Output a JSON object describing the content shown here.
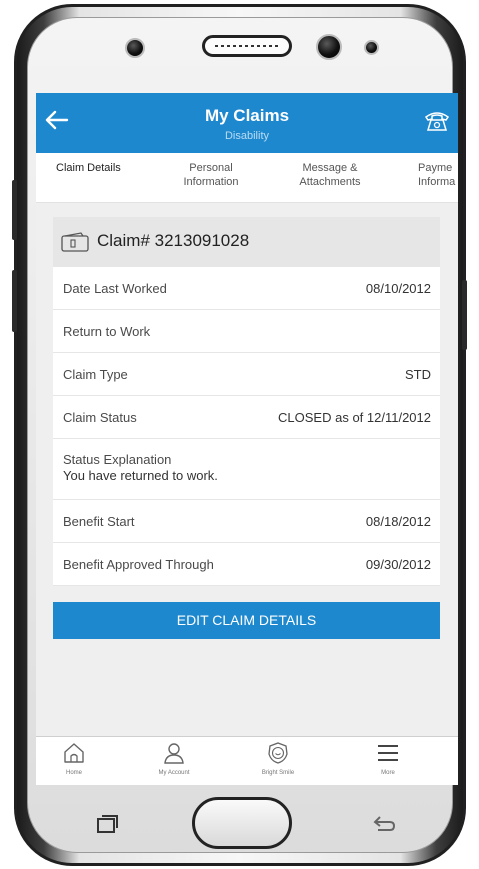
{
  "header": {
    "title": "My Claims",
    "subtitle": "Disability"
  },
  "tabs": [
    {
      "label_line1": "Claim Details",
      "label_line2": ""
    },
    {
      "label_line1": "Personal",
      "label_line2": "Information"
    },
    {
      "label_line1": "Message &",
      "label_line2": "Attachments"
    },
    {
      "label_line1": "Payme",
      "label_line2": "Informa"
    }
  ],
  "claim": {
    "number": "Claim# 3213091028",
    "rows": [
      {
        "label": "Date Last Worked",
        "value": "08/10/2012"
      },
      {
        "label": "Return to Work",
        "value": ""
      },
      {
        "label": "Claim Type",
        "value": "STD"
      },
      {
        "label": "Claim Status",
        "value": "CLOSED as of 12/11/2012"
      },
      {
        "label": "Status Explanation",
        "value": "You have returned to work."
      },
      {
        "label": "Benefit Start",
        "value": "08/18/2012"
      },
      {
        "label": "Benefit Approved Through",
        "value": "09/30/2012"
      }
    ]
  },
  "actions": {
    "edit_label": "EDIT CLAIM DETAILS"
  },
  "bottom_nav": [
    {
      "label": "Home",
      "icon": "home-icon"
    },
    {
      "label": "My Account",
      "icon": "user-icon"
    },
    {
      "label": "Bright Smile",
      "icon": "smile-badge-icon"
    },
    {
      "label": "More",
      "icon": "hamburger-icon"
    }
  ],
  "colors": {
    "primary": "#1e88cf",
    "background": "#efefef",
    "card_header": "#e6e6e6"
  }
}
